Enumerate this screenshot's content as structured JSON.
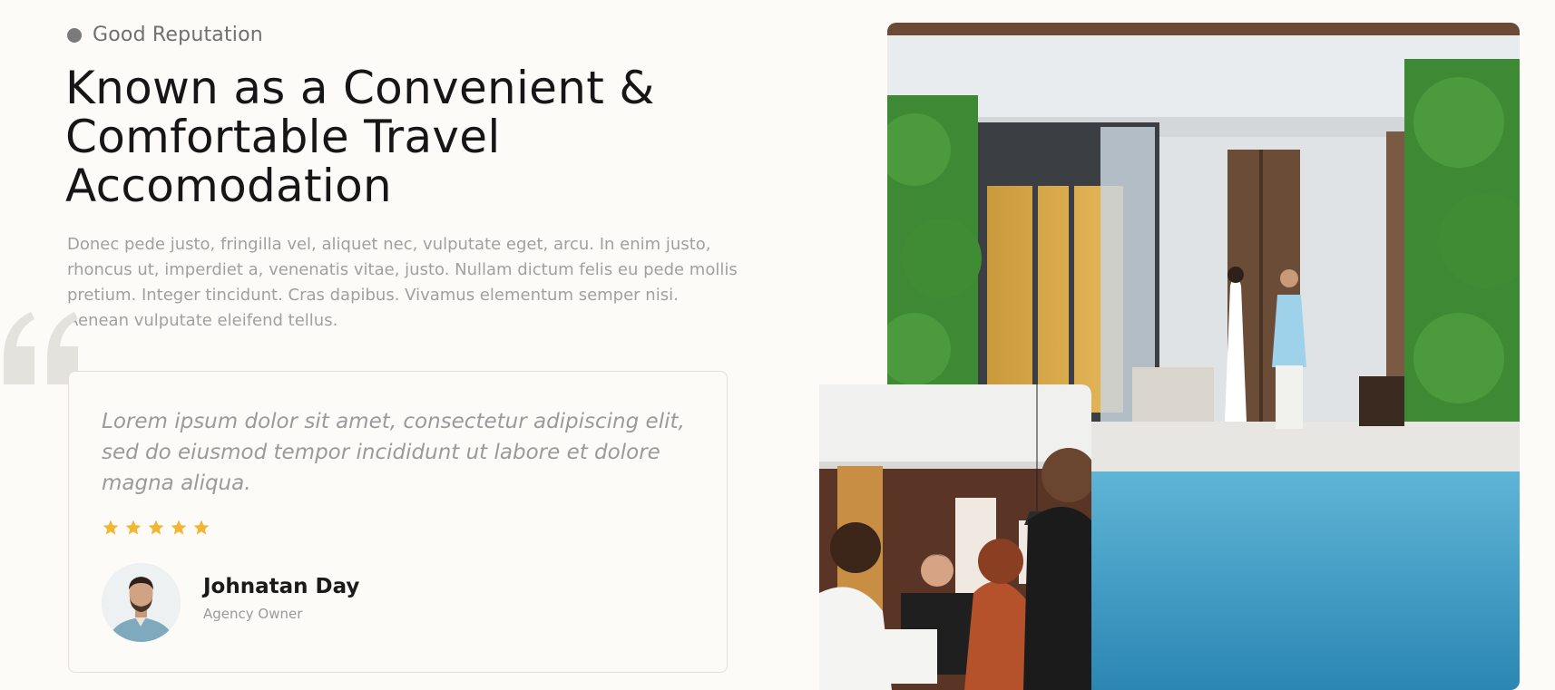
{
  "section": {
    "eyebrow": "Good Reputation",
    "heading": "Known as a Convenient & Comfortable Travel Accomodation",
    "description": "Donec pede justo, fringilla vel, aliquet nec, vulputate eget, arcu. In enim justo, rhoncus ut, imperdiet a, venenatis vitae, justo. Nullam dictum felis eu pede mollis pretium. Integer tincidunt. Cras dapibus. Vivamus elementum semper nisi. Aenean vulputate eleifend tellus."
  },
  "testimonial": {
    "quote": "Lorem ipsum dolor sit amet, consectetur adipiscing elit, sed do eiusmod tempor incididunt ut labore et dolore magna aliqua.",
    "rating": 5,
    "rating_max": 5,
    "author_name": "Johnatan Day",
    "author_role": "Agency Owner"
  },
  "icons": {
    "quote": "quote-open-icon",
    "rating": "star-icon",
    "bullet": "dot-icon"
  },
  "colors": {
    "background": "#fcfbf8",
    "heading": "#161616",
    "muted_text": "#a0a0a0",
    "star": "#f3b532",
    "card_border": "#e3e0da"
  }
}
